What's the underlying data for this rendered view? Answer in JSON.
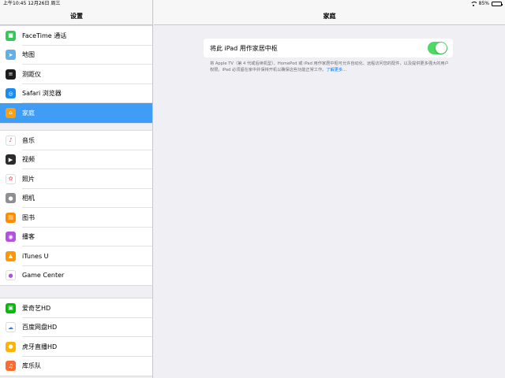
{
  "status_bar": {
    "time_date": "上午10:45  12月26日 周三",
    "battery": "85%",
    "battery_level": 0.85
  },
  "sidebar": {
    "title": "设置",
    "groups": [
      {
        "items": [
          {
            "label": "FaceTime 通话",
            "icon": "facetime-icon",
            "color": "#34c759"
          },
          {
            "label": "地图",
            "icon": "maps-icon",
            "color": "#5fb0e9"
          },
          {
            "label": "测距仪",
            "icon": "measure-icon",
            "color": "#1c1c1e"
          },
          {
            "label": "Safari 浏览器",
            "icon": "safari-icon",
            "color": "#1a8cf0"
          },
          {
            "label": "家庭",
            "icon": "home-icon",
            "color": "#ff9f0a",
            "selected": true
          }
        ]
      },
      {
        "items": [
          {
            "label": "音乐",
            "icon": "music-icon",
            "color": "#ffffff"
          },
          {
            "label": "视频",
            "icon": "videos-icon",
            "color": "#2b2b2b"
          },
          {
            "label": "照片",
            "icon": "photos-icon",
            "color": "#ffffff"
          },
          {
            "label": "相机",
            "icon": "camera-icon",
            "color": "#8e8e93"
          },
          {
            "label": "图书",
            "icon": "books-icon",
            "color": "#ff8c00"
          },
          {
            "label": "播客",
            "icon": "podcasts-icon",
            "color": "#b452e0"
          },
          {
            "label": "iTunes U",
            "icon": "itunes-u-icon",
            "color": "#ff9500"
          },
          {
            "label": "Game Center",
            "icon": "game-center-icon",
            "color": "#ffffff"
          }
        ]
      },
      {
        "items": [
          {
            "label": "爱奇艺HD",
            "icon": "iqiyi-icon",
            "color": "#00be06"
          },
          {
            "label": "百度网盘HD",
            "icon": "baidu-netdisk-icon",
            "color": "#ffffff"
          },
          {
            "label": "虎牙直播HD",
            "icon": "huya-icon",
            "color": "#ffb300"
          },
          {
            "label": "库乐队",
            "icon": "garageband-icon",
            "color": "#ff6b2d"
          }
        ]
      }
    ]
  },
  "detail": {
    "title": "家庭",
    "toggle_label": "将此 iPad 用作家居中枢",
    "toggle_on": true,
    "footnote": "将 Apple TV（第 4 代或后续机型）、HomePod 或 iPad 用作家居中枢可允许自动化、远程访问您的配件，以及提供更多强大的用户权限。iPad 必须留在家中并保持开机以确保这些功能正常工作。",
    "footnote_link": "了解更多…",
    "accent_color": "#4cd964",
    "selection_color": "#3f9df5"
  }
}
